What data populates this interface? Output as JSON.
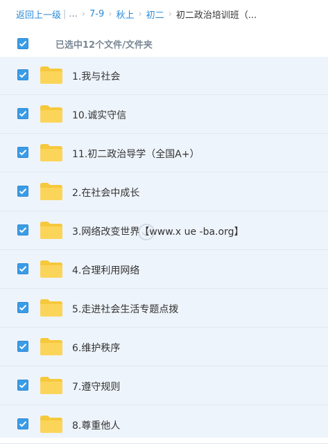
{
  "breadcrumb": {
    "back": "返回上一级",
    "pipe": "|",
    "dots": "...",
    "sep": "›",
    "items": [
      "7-9",
      "秋上",
      "初二"
    ],
    "current": "初二政治培训班（..."
  },
  "selection": {
    "checked": true,
    "text": "已选中12个文件/文件夹"
  },
  "files": [
    {
      "name": "1.我与社会",
      "checked": true
    },
    {
      "name": "10.诚实守信",
      "checked": true
    },
    {
      "name": "11.初二政治导学（全国A+）",
      "checked": true
    },
    {
      "name": "2.在社会中成长",
      "checked": true
    },
    {
      "name": "3.网络改变世界【www.x ue -ba.org】",
      "checked": true
    },
    {
      "name": "4.合理利用网络",
      "checked": true
    },
    {
      "name": "5.走进社会生活专题点拨",
      "checked": true
    },
    {
      "name": "6.维护秩序",
      "checked": true
    },
    {
      "name": "7.遵守规则",
      "checked": true
    },
    {
      "name": "8.尊重他人",
      "checked": true
    }
  ],
  "colors": {
    "accent": "#2a8ad8",
    "checkbox": "#3b9ce6",
    "folder": "#f6c83c",
    "list_bg": "#eef4fb"
  },
  "icons": {
    "checkbox": "check-icon",
    "folder": "folder-icon"
  }
}
